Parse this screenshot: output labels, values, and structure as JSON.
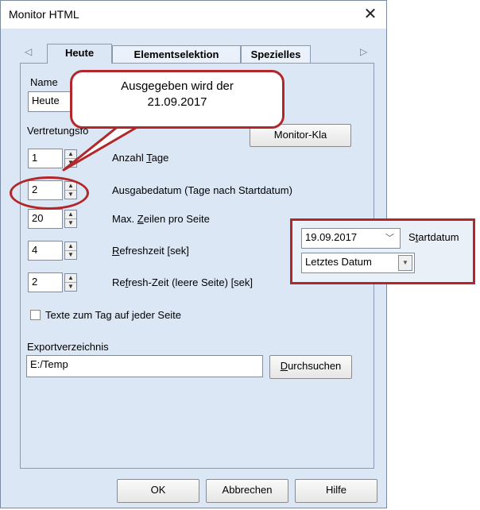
{
  "window": {
    "title": "Monitor HTML",
    "close_glyph": "✕"
  },
  "tabs": [
    {
      "label": "Heute"
    },
    {
      "label": "Elementselektion"
    },
    {
      "label": "Spezielles"
    }
  ],
  "tab_arrows": {
    "left": "◁",
    "right": "▷"
  },
  "form": {
    "name_label": "Name",
    "name_value": "Heute",
    "vertretungsformat_label": "Vertretungsfo",
    "monitor_button": "Monitor-Kla",
    "rows": [
      {
        "value": "1",
        "label_pre": "Anzahl ",
        "label_u": "T",
        "label_post": "age"
      },
      {
        "value": "2",
        "label_pre": "Ausgabedatum (Tage nach Startdatum)",
        "label_u": "",
        "label_post": ""
      },
      {
        "value": "20",
        "label_pre": "Max. ",
        "label_u": "Z",
        "label_post": "eilen pro Seite"
      },
      {
        "value": "4",
        "label_pre": "",
        "label_u": "R",
        "label_post": "efreshzeit [sek]"
      },
      {
        "value": "2",
        "label_pre": "Re",
        "label_u": "f",
        "label_post": "resh-Zeit (leere Seite) [sek]"
      }
    ],
    "checkbox_label": "Texte zum Tag auf jeder Seite",
    "checkbox_checked": false,
    "export_label": "Exportverzeichnis",
    "export_value": "E:/Temp",
    "browse_pre": "",
    "browse_u": "D",
    "browse_post": "urchsuchen"
  },
  "buttons": {
    "ok": "OK",
    "cancel": "Abbrechen",
    "help": "Hilfe"
  },
  "callout": {
    "line1": "Ausgegeben wird der",
    "line2": "21.09.2017"
  },
  "startdatum": {
    "date_value": "19.09.2017",
    "label_pre": "S",
    "label_u": "t",
    "label_post": "artdatum",
    "dropdown_value": "Letztes Datum"
  },
  "colors": {
    "accent_red": "#b2282a",
    "dialog_bg": "#dce7f5"
  }
}
